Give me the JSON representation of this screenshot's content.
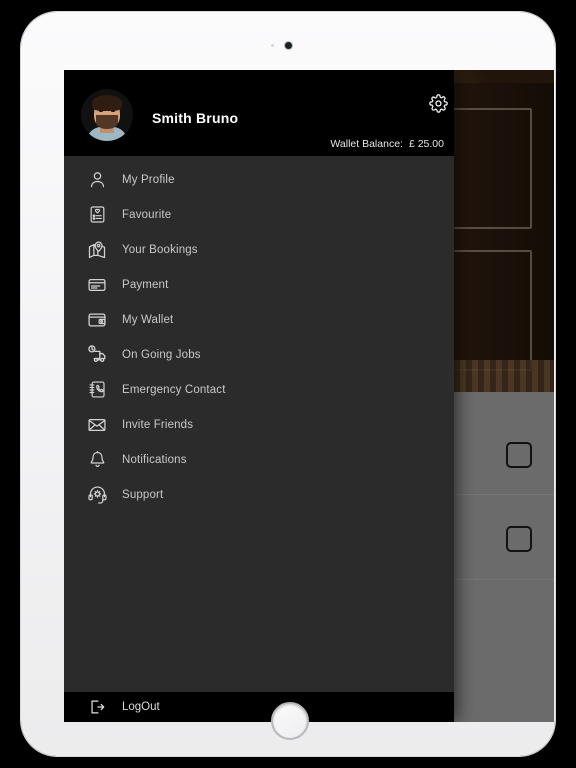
{
  "device": {
    "name": "ipad-tablet",
    "camera": "front-camera",
    "home_button": "home-button"
  },
  "header": {
    "user_name": "Smith Bruno",
    "avatar_alt": "user-avatar",
    "settings_icon": "gear-icon",
    "wallet_label": "Wallet Balance:",
    "wallet_amount": "£ 25.00"
  },
  "menu": {
    "items": [
      {
        "label": "My Profile",
        "icon": "person-icon"
      },
      {
        "label": "Favourite",
        "icon": "clipboard-heart-icon"
      },
      {
        "label": "Your Bookings",
        "icon": "map-pin-icon"
      },
      {
        "label": "Payment",
        "icon": "credit-card-icon"
      },
      {
        "label": "My Wallet",
        "icon": "wallet-icon"
      },
      {
        "label": "On Going Jobs",
        "icon": "truck-clock-icon"
      },
      {
        "label": "Emergency Contact",
        "icon": "phone-book-icon"
      },
      {
        "label": "Invite Friends",
        "icon": "envelope-icon"
      },
      {
        "label": "Notifications",
        "icon": "bell-icon"
      },
      {
        "label": "Support",
        "icon": "headset-gear-icon"
      }
    ]
  },
  "footer": {
    "logout_label": "LogOut",
    "logout_icon": "logout-arrow-icon"
  },
  "background": {
    "hero_alt": "barbershop-interior-photo",
    "rows": [
      {
        "checkbox": "selection-checkbox"
      },
      {
        "checkbox": "selection-checkbox"
      }
    ]
  },
  "colors": {
    "drawer_bg": "#2b2b2b",
    "header_bg": "#000000",
    "menu_text": "#c9c9c9",
    "scrim": "#8a8a8a"
  }
}
